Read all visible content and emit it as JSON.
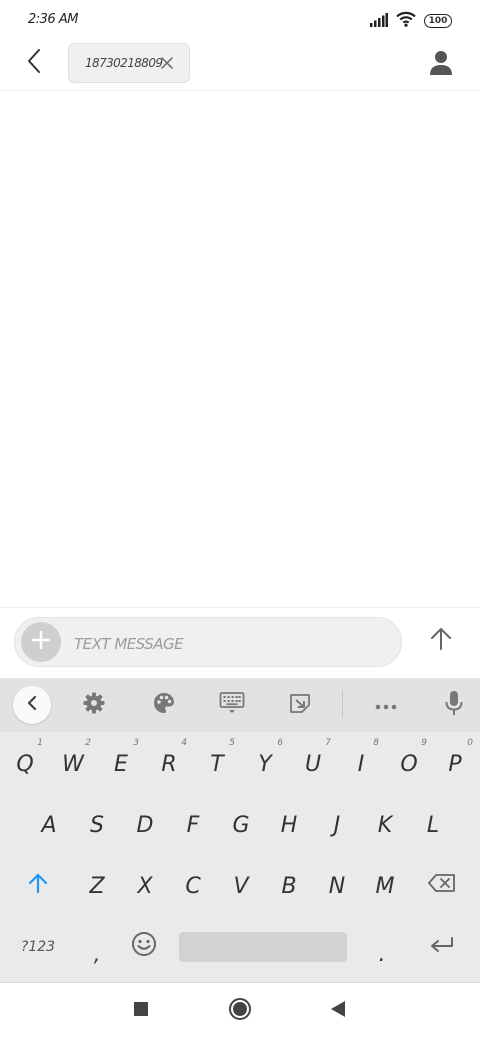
{
  "status_bar": {
    "time": "2:36 AM",
    "battery": "100",
    "icons": [
      "signal-icon",
      "wifi-icon",
      "battery-icon"
    ]
  },
  "header": {
    "recipient": "18730218809",
    "icons": [
      "back-arrow-icon",
      "close-icon",
      "contact-icon"
    ]
  },
  "compose": {
    "placeholder": "TEXT MESSAGE",
    "icons": [
      "plus-icon",
      "send-arrow-icon"
    ]
  },
  "keyboard": {
    "toolbar_icons": [
      "chevron-left-icon",
      "gear-icon",
      "palette-icon",
      "keyboard-icon",
      "resize-icon",
      "more-icon",
      "microphone-icon"
    ],
    "row1": [
      {
        "label": "Q",
        "hint": "1"
      },
      {
        "label": "W",
        "hint": "2"
      },
      {
        "label": "E",
        "hint": "3"
      },
      {
        "label": "R",
        "hint": "4"
      },
      {
        "label": "T",
        "hint": "5"
      },
      {
        "label": "Y",
        "hint": "6"
      },
      {
        "label": "U",
        "hint": "7"
      },
      {
        "label": "I",
        "hint": "8"
      },
      {
        "label": "O",
        "hint": "9"
      },
      {
        "label": "P",
        "hint": "0"
      }
    ],
    "row2": [
      "A",
      "S",
      "D",
      "F",
      "G",
      "H",
      "J",
      "K",
      "L"
    ],
    "row3": [
      "Z",
      "X",
      "C",
      "V",
      "B",
      "N",
      "M"
    ],
    "symbols_label": "?123",
    "comma_label": ",",
    "period_label": ".",
    "accent_color": "#2196f3"
  },
  "navbar": {
    "icons": [
      "recents-square-icon",
      "home-circle-icon",
      "back-triangle-icon"
    ]
  }
}
